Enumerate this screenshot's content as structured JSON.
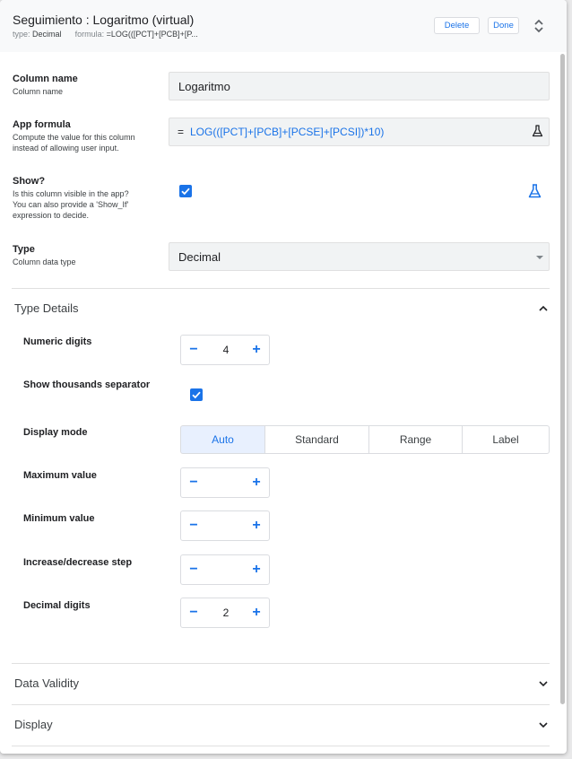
{
  "header": {
    "title": "Seguimiento : Logaritmo (virtual)",
    "type_label": "type:",
    "type_value": "Decimal",
    "formula_label": "formula:",
    "formula_value": "=LOG(([PCT]+[PCB]+[P...",
    "delete_label": "Delete",
    "done_label": "Done"
  },
  "column_name": {
    "label": "Column name",
    "description": "Column name",
    "value": "Logaritmo"
  },
  "app_formula": {
    "label": "App formula",
    "description_line1": "Compute the value for this column",
    "description_line2": "instead of allowing user input.",
    "equals": "=",
    "value": "LOG(([PCT]+[PCB]+[PCSE]+[PCSI])*10)"
  },
  "show": {
    "label": "Show?",
    "description_line1": "Is this column visible in the app?",
    "description_line2": "You can also provide a 'Show_If'",
    "description_line3": "expression to decide.",
    "checked": true
  },
  "type": {
    "label": "Type",
    "description": "Column data type",
    "value": "Decimal"
  },
  "type_details": {
    "title": "Type Details",
    "numeric_digits": {
      "label": "Numeric digits",
      "value": "4"
    },
    "thousands_separator": {
      "label": "Show thousands separator",
      "checked": true
    },
    "display_mode": {
      "label": "Display mode",
      "options": [
        "Auto",
        "Standard",
        "Range",
        "Label"
      ],
      "selected": "Auto"
    },
    "maximum_value": {
      "label": "Maximum value",
      "value": ""
    },
    "minimum_value": {
      "label": "Minimum value",
      "value": ""
    },
    "step": {
      "label": "Increase/decrease step",
      "value": ""
    },
    "decimal_digits": {
      "label": "Decimal digits",
      "value": "2"
    },
    "minus_symbol": "−",
    "plus_symbol": "+"
  },
  "sections": {
    "data_validity": "Data Validity",
    "display": "Display"
  },
  "colors": {
    "accent": "#1a73e8",
    "header_bg": "#f8f9fa",
    "field_bg": "#f1f3f4",
    "active_segment_bg": "#e8f0fe"
  },
  "icons": [
    "expand-collapse-icon",
    "flask-icon",
    "checkmark-icon",
    "chevron-up-icon",
    "chevron-down-icon",
    "dropdown-caret-icon"
  ]
}
